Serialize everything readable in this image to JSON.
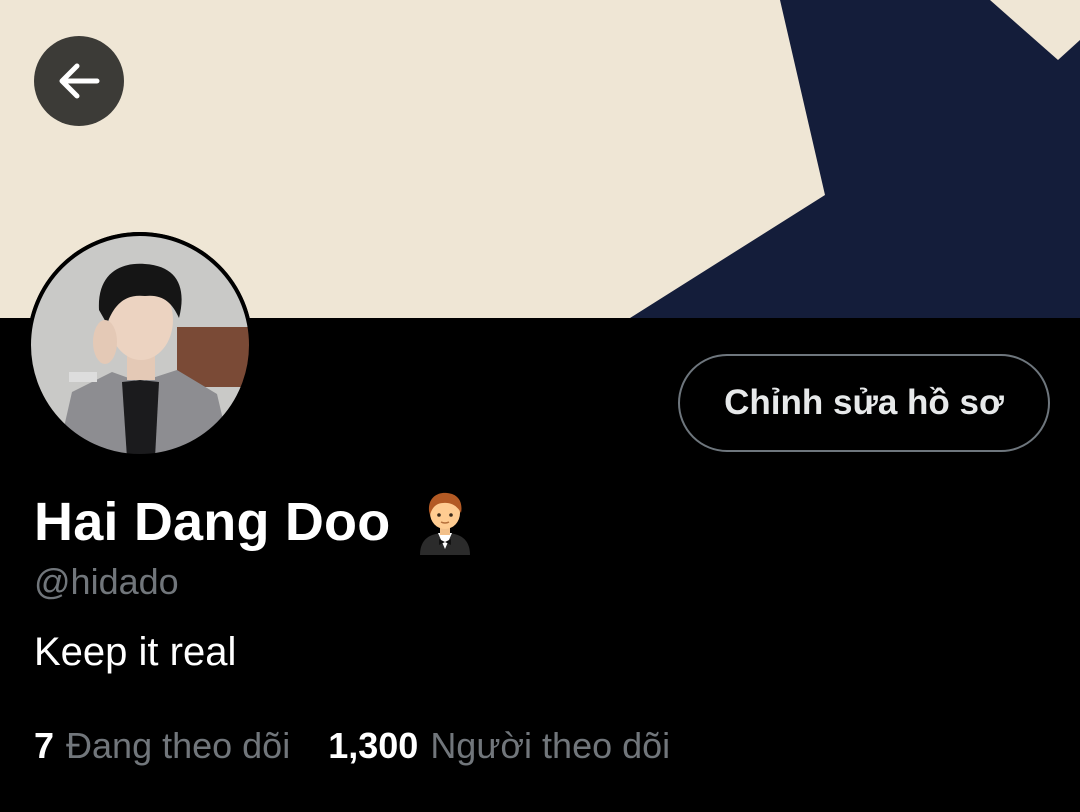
{
  "profile": {
    "display_name": "Hai Dang Doo",
    "handle": "@hidado",
    "bio": "Keep it real",
    "name_emoji": "man-in-tuxedo-icon"
  },
  "actions": {
    "edit_profile_label": "Chỉnh sửa hồ sơ",
    "back_icon": "arrow-left-icon"
  },
  "stats": {
    "following_count": "7",
    "following_label": "Đang theo dõi",
    "followers_count": "1,300",
    "followers_label": "Người theo dõi"
  },
  "colors": {
    "banner_cream": "#efe6d5",
    "banner_navy": "#141d3a",
    "background": "#000000",
    "secondary_text": "#71767b",
    "button_border": "#6e767d"
  }
}
